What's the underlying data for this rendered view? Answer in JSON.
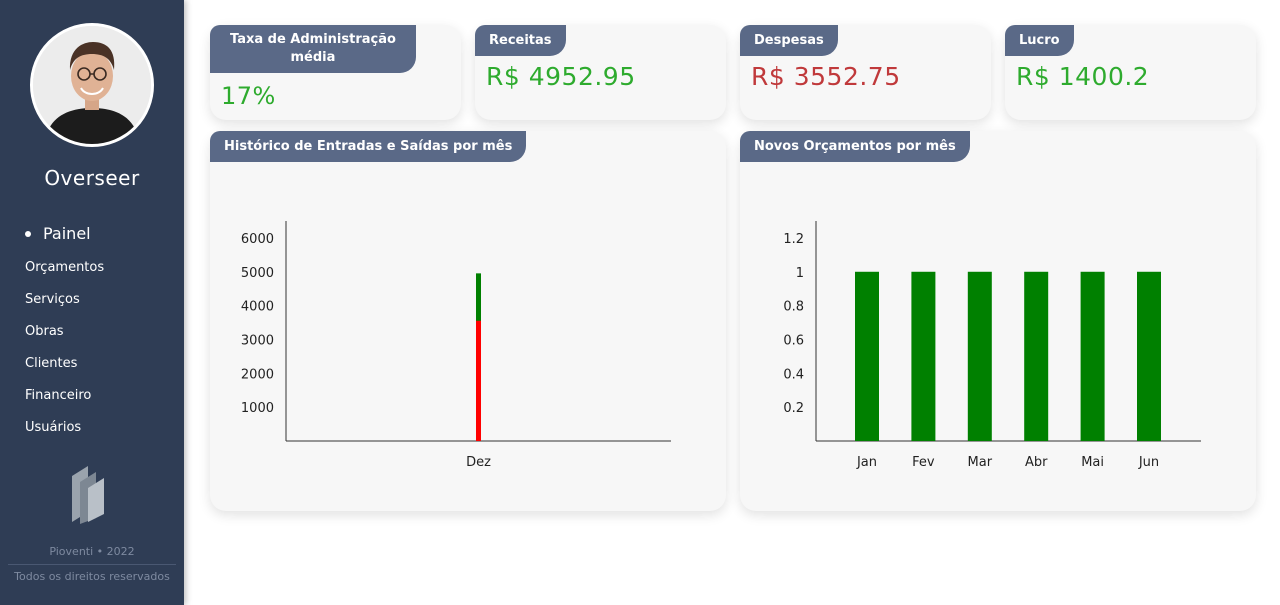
{
  "sidebar": {
    "brand": "Overseer",
    "active_item": "Painel",
    "items": [
      "Orçamentos",
      "Serviços",
      "Obras",
      "Clientes",
      "Financeiro",
      "Usuários"
    ],
    "footer_year": "Pioventi • 2022",
    "footer_rights": "Todos os direitos reservados"
  },
  "kpis": {
    "admin_fee": {
      "label_line1": "Taxa de Administração",
      "label_line2": "média",
      "value": "17%"
    },
    "revenue": {
      "label": "Receitas",
      "value": "R$ 4952.95"
    },
    "expenses": {
      "label": "Despesas",
      "value": "R$ 3552.75"
    },
    "profit": {
      "label": "Lucro",
      "value": "R$ 1400.2"
    }
  },
  "colors": {
    "sidebar": "#2f3d55",
    "tag": "#5a6987",
    "positive": "#2eab2e",
    "negative": "#c0393b",
    "bar_green": "#008000",
    "bar_red": "#ff0000"
  },
  "chart_data": [
    {
      "type": "bar",
      "title": "Histórico de Entradas e Saídas por mês",
      "categories": [
        "Dez"
      ],
      "series": [
        {
          "values": [
            3552.75
          ],
          "color": "#ff0000"
        },
        {
          "values": [
            4952.95
          ],
          "color": "#008000"
        }
      ],
      "yticks": [
        1000,
        2000,
        3000,
        4000,
        5000,
        6000
      ],
      "ylim": [
        0,
        6500
      ]
    },
    {
      "type": "bar",
      "title": "Novos Orçamentos por mês",
      "categories": [
        "Jan",
        "Fev",
        "Mar",
        "Abr",
        "Mai",
        "Jun"
      ],
      "values": [
        1,
        1,
        1,
        1,
        1,
        1
      ],
      "color": "#008000",
      "yticks": [
        0.2,
        0.4,
        0.6,
        0.8,
        1,
        1.2
      ],
      "ylim": [
        0,
        1.3
      ]
    }
  ]
}
